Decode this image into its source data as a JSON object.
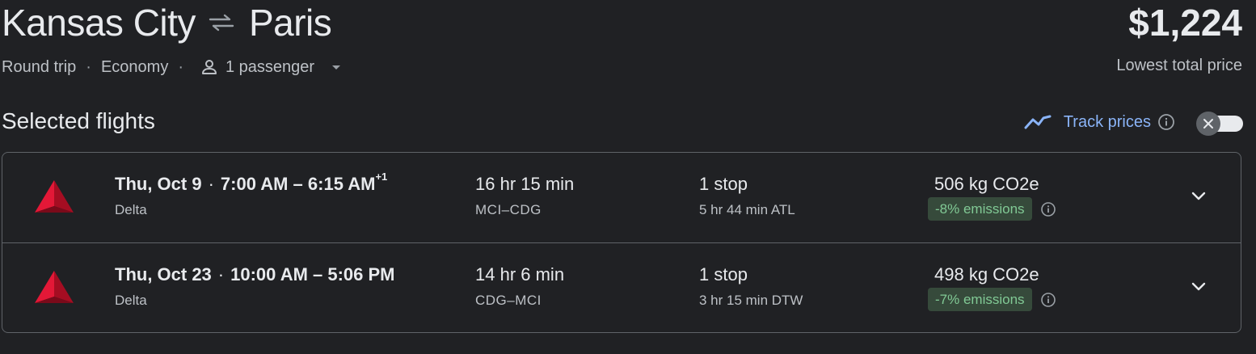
{
  "header": {
    "origin": "Kansas City",
    "destination": "Paris",
    "swap_icon": "swap-arrows-icon",
    "price": "$1,224",
    "price_label": "Lowest total price",
    "trip_type": "Round trip",
    "cabin": "Economy",
    "passengers": "1 passenger",
    "separator": "·"
  },
  "section": {
    "title": "Selected flights",
    "track_label": "Track prices",
    "track_enabled": false
  },
  "flights": [
    {
      "date": "Thu, Oct 9",
      "times": "7:00 AM – 6:15 AM",
      "day_offset": "+1",
      "airline": "Delta",
      "duration": "16 hr 15 min",
      "route": "MCI–CDG",
      "stops": "1 stop",
      "layover": "5 hr 44 min ATL",
      "co2": "506 kg CO2e",
      "emissions": "-8% emissions"
    },
    {
      "date": "Thu, Oct 23",
      "times": "10:00 AM – 5:06 PM",
      "day_offset": "",
      "airline": "Delta",
      "duration": "14 hr 6 min",
      "route": "CDG–MCI",
      "stops": "1 stop",
      "layover": "3 hr 15 min DTW",
      "co2": "498 kg CO2e",
      "emissions": "-7% emissions"
    }
  ],
  "colors": {
    "background": "#202124",
    "text": "#e8eaed",
    "muted": "#bdc1c6",
    "link": "#8ab4f8",
    "emissions_bg": "#364a3b",
    "emissions_text": "#81c995",
    "delta_red": "#c8102e"
  }
}
